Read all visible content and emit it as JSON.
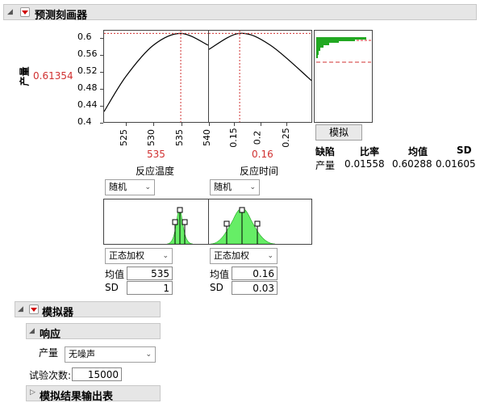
{
  "prediction_profiler": {
    "title": "预测刻画器",
    "response_label": "产量",
    "response_value": "0.61354",
    "y_ticks": [
      "0.6",
      "0.56",
      "0.52",
      "0.48",
      "0.44",
      "0.4"
    ],
    "factors": [
      {
        "name": "反应温度",
        "current": "535",
        "x_ticks": [
          "525",
          "530",
          "535",
          "540"
        ],
        "dist_type": "随机",
        "weight_type": "正态加权",
        "mean_label": "均值",
        "mean_value": "535",
        "sd_label": "SD",
        "sd_value": "1"
      },
      {
        "name": "反应时间",
        "current": "0.16",
        "x_ticks": [
          "0.15",
          "0.2",
          "0.25"
        ],
        "dist_type": "随机",
        "weight_type": "正态加权",
        "mean_label": "均值",
        "mean_value": "0.16",
        "sd_label": "SD",
        "sd_value": "0.03"
      }
    ],
    "simulate_button": "模拟",
    "defect_table": {
      "headers": [
        "缺陷",
        "比率",
        "均值",
        "SD"
      ],
      "row": {
        "name": "产量",
        "rate": "0.01558",
        "mean": "0.60288",
        "sd": "0.01605"
      }
    }
  },
  "simulator": {
    "title": "模拟器",
    "response_section": {
      "title": "响应",
      "response_label": "产量",
      "noise_option": "无噪声",
      "runs_label": "试验次数:",
      "runs_value": "15000"
    },
    "output_table_title": "模拟结果输出表"
  },
  "colors": {
    "accent_red": "#d03030",
    "green_fill": "#66ee66",
    "green_bar": "#22a822"
  },
  "chart_data": [
    {
      "type": "line",
      "series": [
        {
          "x": [
            521,
            525,
            530,
            535,
            540
          ],
          "y": [
            0.425,
            0.51,
            0.585,
            0.6135,
            0.585
          ]
        }
      ],
      "xlabel": "反应温度",
      "ylabel": "产量",
      "ylim": [
        0.4,
        0.62
      ],
      "xlim": [
        521,
        540
      ],
      "current_x": 535,
      "current_y": 0.61354
    },
    {
      "type": "line",
      "series": [
        {
          "x": [
            0.1,
            0.16,
            0.22,
            0.3
          ],
          "y": [
            0.575,
            0.6135,
            0.585,
            0.5
          ]
        }
      ],
      "xlabel": "反应时间",
      "ylim": [
        0.4,
        0.62
      ],
      "xlim": [
        0.1,
        0.3
      ],
      "current_x": 0.16,
      "current_y": 0.61354
    }
  ]
}
